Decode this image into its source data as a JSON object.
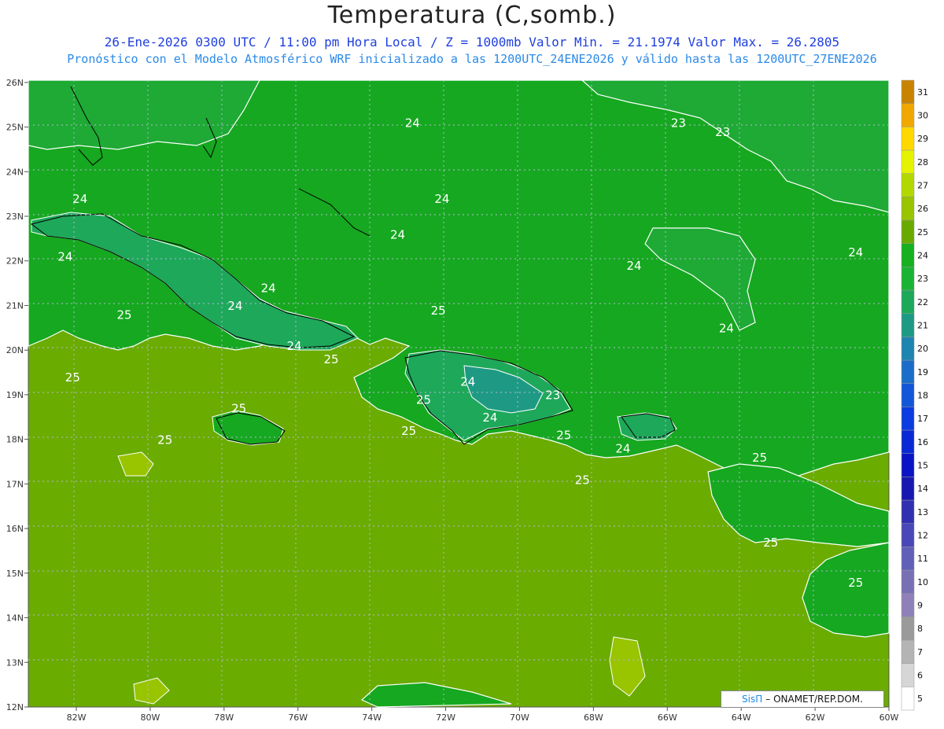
{
  "header": {
    "title": "Temperatura (C,somb.)",
    "line1": "26-Ene-2026 0300 UTC / 11:00 pm Hora Local / Z = 1000mb  Valor Min. = 21.1974  Valor Max. = 26.2805",
    "line2": "Pronóstico con el Modelo Atmosférico WRF inicializado a las 1200UTC_24ENE2026 y válido hasta las  1200UTC_27ENE2026"
  },
  "axes": {
    "lat_labels": [
      "26N",
      "25N",
      "24N",
      "23N",
      "22N",
      "21N",
      "20N",
      "19N",
      "18N",
      "17N",
      "16N",
      "15N",
      "14N",
      "13N",
      "12N"
    ],
    "lon_labels": [
      "82W",
      "80W",
      "78W",
      "76W",
      "74W",
      "72W",
      "70W",
      "68W",
      "66W",
      "64W",
      "62W",
      "60W"
    ]
  },
  "contour_labels": [
    {
      "text": "24",
      "lon": -72.9,
      "lat": 25.0
    },
    {
      "text": "23",
      "lon": -65.7,
      "lat": 25.0
    },
    {
      "text": "23",
      "lon": -64.5,
      "lat": 24.8
    },
    {
      "text": "24",
      "lon": -81.9,
      "lat": 23.3
    },
    {
      "text": "24",
      "lon": -73.3,
      "lat": 22.5
    },
    {
      "text": "24",
      "lon": -72.1,
      "lat": 23.3
    },
    {
      "text": "24",
      "lon": -82.3,
      "lat": 22.0
    },
    {
      "text": "24",
      "lon": -60.9,
      "lat": 22.1
    },
    {
      "text": "24",
      "lon": -66.9,
      "lat": 21.8
    },
    {
      "text": "24",
      "lon": -76.8,
      "lat": 21.3
    },
    {
      "text": "24",
      "lon": -77.7,
      "lat": 20.9
    },
    {
      "text": "25",
      "lon": -80.7,
      "lat": 20.7
    },
    {
      "text": "25",
      "lon": -72.2,
      "lat": 20.8
    },
    {
      "text": "24",
      "lon": -76.1,
      "lat": 20.0
    },
    {
      "text": "25",
      "lon": -75.1,
      "lat": 19.7
    },
    {
      "text": "24",
      "lon": -64.4,
      "lat": 20.4
    },
    {
      "text": "25",
      "lon": -82.1,
      "lat": 19.3
    },
    {
      "text": "24",
      "lon": -71.4,
      "lat": 19.2
    },
    {
      "text": "23",
      "lon": -69.1,
      "lat": 18.9
    },
    {
      "text": "25",
      "lon": -72.6,
      "lat": 18.8
    },
    {
      "text": "25",
      "lon": -77.6,
      "lat": 18.6
    },
    {
      "text": "24",
      "lon": -70.8,
      "lat": 18.4
    },
    {
      "text": "25",
      "lon": -73.0,
      "lat": 18.1
    },
    {
      "text": "25",
      "lon": -79.6,
      "lat": 17.9
    },
    {
      "text": "25",
      "lon": -68.8,
      "lat": 18.0
    },
    {
      "text": "24",
      "lon": -67.2,
      "lat": 17.7
    },
    {
      "text": "25",
      "lon": -63.5,
      "lat": 17.5
    },
    {
      "text": "25",
      "lon": -68.3,
      "lat": 17.0
    },
    {
      "text": "25",
      "lon": -63.2,
      "lat": 15.6
    },
    {
      "text": "25",
      "lon": -60.9,
      "lat": 14.7
    }
  ],
  "colorbar": {
    "labels": [
      "5",
      "6",
      "7",
      "8",
      "9",
      "10",
      "11",
      "12",
      "13",
      "14",
      "15",
      "16",
      "17",
      "18",
      "19",
      "20",
      "21",
      "22",
      "23",
      "24",
      "25",
      "26",
      "27",
      "28",
      "29",
      "30",
      "31"
    ],
    "colors": [
      "#ffffff",
      "#d6d6d6",
      "#b4b4b4",
      "#9a9a9a",
      "#9080b8",
      "#7870b4",
      "#6060b8",
      "#4848b8",
      "#3030b0",
      "#1818b0",
      "#0a14c4",
      "#0a28d4",
      "#0a3ce0",
      "#1456d8",
      "#1a6ec8",
      "#1e84b0",
      "#1e9a84",
      "#1ea85a",
      "#1ab434",
      "#16b020",
      "#6aaa00",
      "#98c400",
      "#b2d800",
      "#e4f400",
      "#ffd800",
      "#f0a800",
      "#c88400"
    ]
  },
  "credit": {
    "brand": "SisΠ",
    "text": "– ONAMET/REP.DOM."
  }
}
